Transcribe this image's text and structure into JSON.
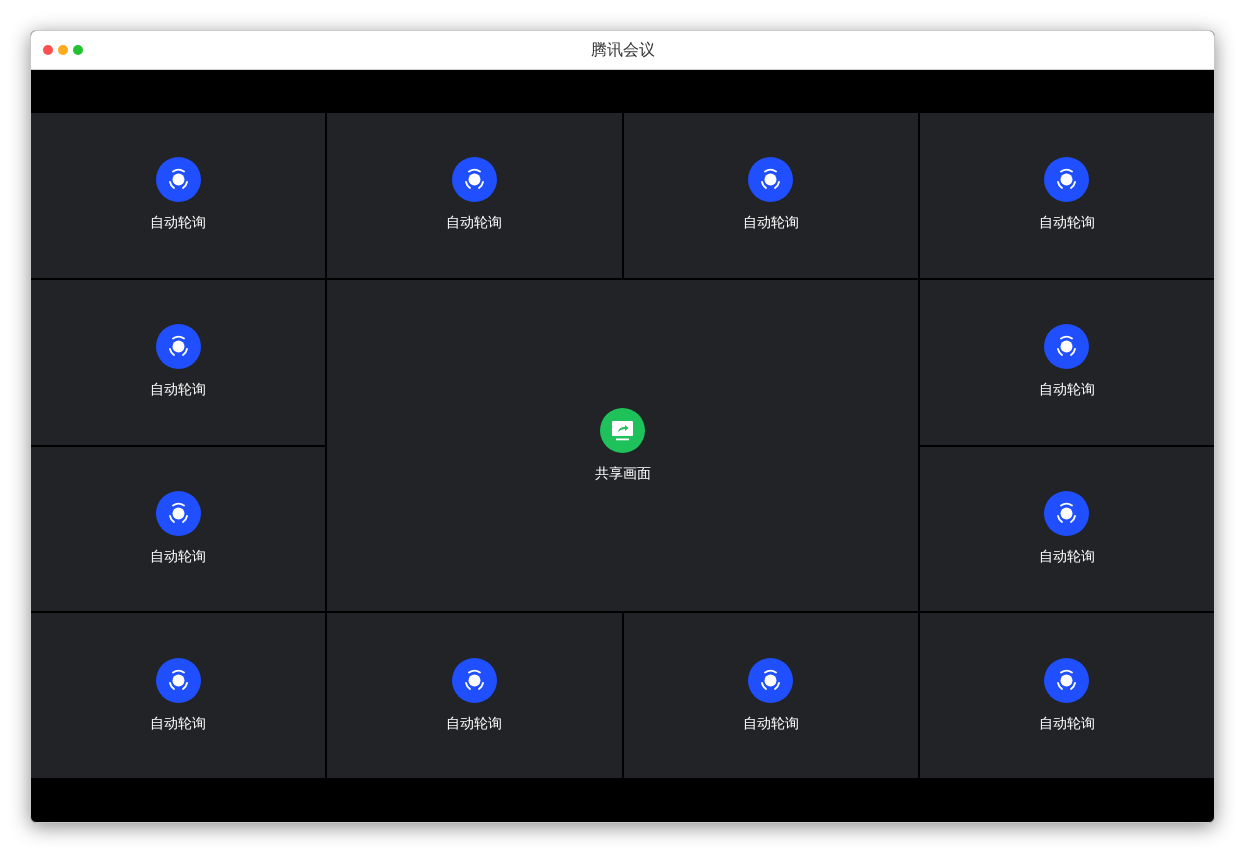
{
  "window": {
    "title": "腾讯会议"
  },
  "tiles": [
    {
      "kind": "polling",
      "label": "自动轮询"
    },
    {
      "kind": "polling",
      "label": "自动轮询"
    },
    {
      "kind": "polling",
      "label": "自动轮询"
    },
    {
      "kind": "polling",
      "label": "自动轮询"
    },
    {
      "kind": "polling",
      "label": "自动轮询"
    },
    {
      "kind": "share",
      "label": "共享画面"
    },
    {
      "kind": "polling",
      "label": "自动轮询"
    },
    {
      "kind": "polling",
      "label": "自动轮询"
    },
    {
      "kind": "polling",
      "label": "自动轮询"
    },
    {
      "kind": "polling",
      "label": "自动轮询"
    },
    {
      "kind": "polling",
      "label": "自动轮询"
    },
    {
      "kind": "polling",
      "label": "自动轮询"
    },
    {
      "kind": "polling",
      "label": "自动轮询"
    }
  ]
}
